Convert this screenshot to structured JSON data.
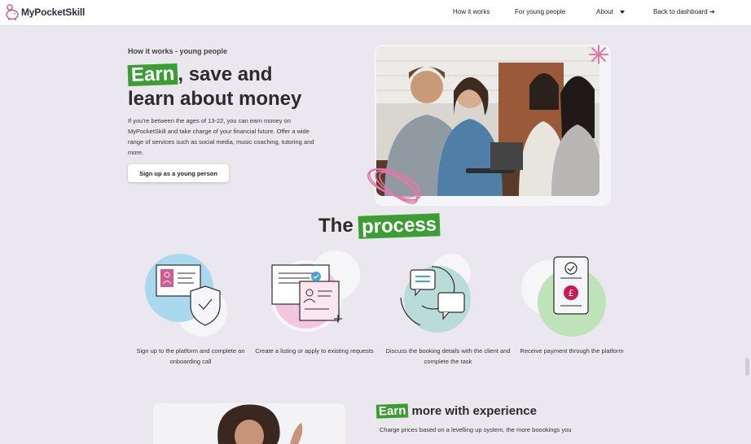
{
  "nav": {
    "logo_text": "MyPocketSkill",
    "how_it_works": "How it works",
    "for_young_people": "For young people",
    "about": "About",
    "back_to_dashboard": "Back to dashboard",
    "back_arrow": "➔"
  },
  "hero": {
    "eyebrow": "How it works - young people",
    "title_highlight": "Earn",
    "title_line1_rest": ", save and",
    "title_line2": "learn about money",
    "description": "If you're between the ages of 13-22, you can earn money on MyPocketSkill and take charge of your financial future. Offer a wide range of services such as social media, music coaching, tutoring and more.",
    "signup_button": "Sign up as a young person"
  },
  "process": {
    "title_plain": "The",
    "title_highlight": "process",
    "steps": [
      {
        "icon": "id-card-shield-icon",
        "caption": "Sign up to the platform and complete an onboarding call"
      },
      {
        "icon": "listing-icon",
        "caption": "Create a listing or apply to existing requests"
      },
      {
        "icon": "chat-bubbles-icon",
        "caption": "Discuss the booking details with the client and complete the task"
      },
      {
        "icon": "phone-payment-icon",
        "caption": "Receive payment through the platform"
      }
    ]
  },
  "experience": {
    "title_highlight": "Earn",
    "title_rest": " more with experience",
    "description": "Charge prices based on a levelling up system, the more boookings you"
  },
  "colors": {
    "accent_green": "#3c9d34",
    "accent_pink": "#e07aa6",
    "circle_blue": "#a9d8ef",
    "circle_pink": "#f2c6dc",
    "circle_teal": "#b9dcd8",
    "circle_green": "#bfe3b8",
    "pound_red": "#c8195a"
  }
}
